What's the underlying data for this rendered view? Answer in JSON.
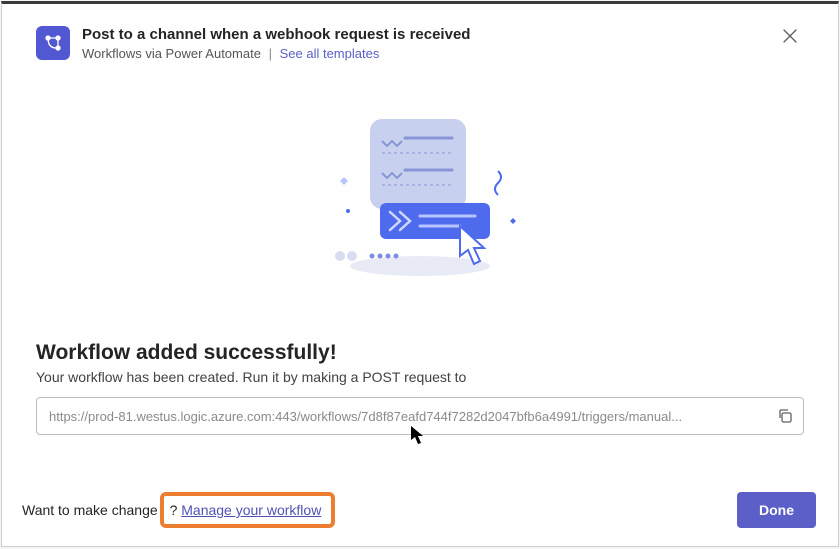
{
  "header": {
    "title": "Post to a channel when a webhook request is received",
    "source": "Workflows via Power Automate",
    "templates_link": "See all templates"
  },
  "success": {
    "title": "Workflow added successfully!",
    "description": "Your workflow has been created. Run it by making a POST request to",
    "url": "https://prod-81.westus.logic.azure.com:443/workflows/7d8f87eafd744f7282d2047bfb6a4991/triggers/manual..."
  },
  "footer": {
    "prompt_prefix": "Want to make change",
    "prompt_suffix_in_box": "? ",
    "manage_link": "Manage your workflow",
    "done_label": "Done"
  }
}
